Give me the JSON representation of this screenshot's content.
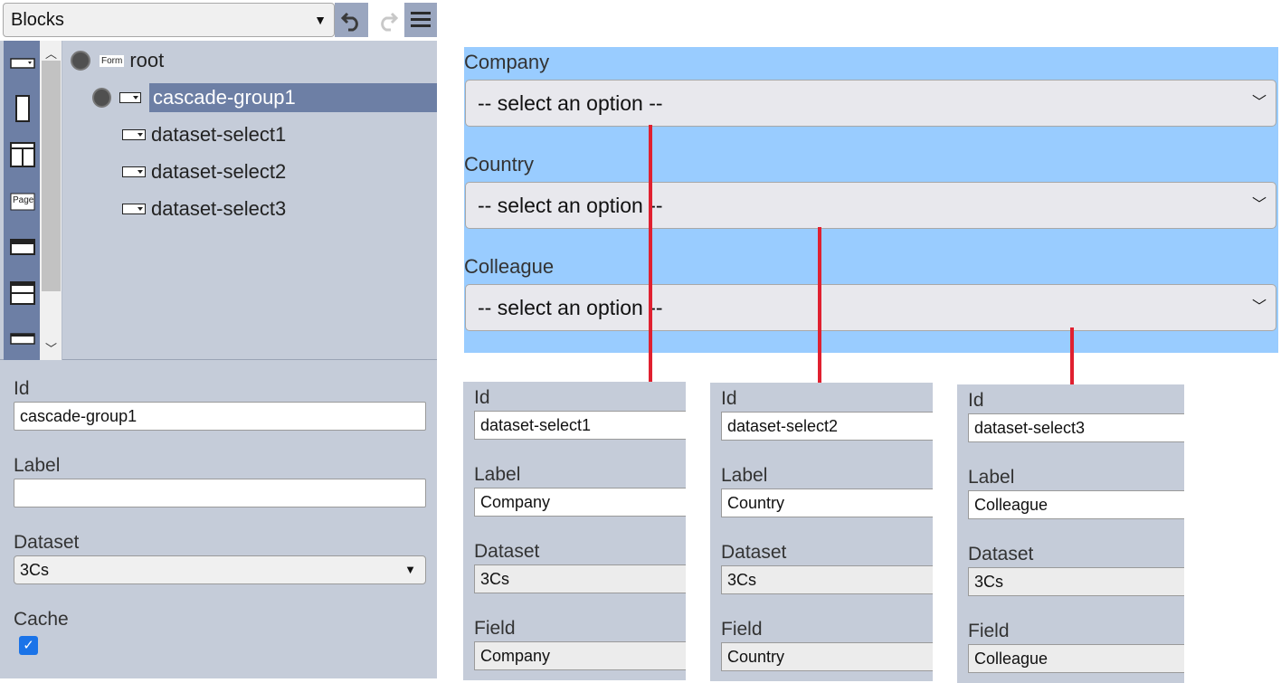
{
  "toolbar": {
    "block_select_value": "Blocks",
    "undo_icon": "undo-icon",
    "redo_icon": "redo-icon",
    "menu_icon": "hamburger-menu-icon"
  },
  "palette": {
    "items": [
      "dropdown-icon",
      "single-panel-icon",
      "two-column-icon",
      "page-icon",
      "header-bar-icon",
      "split-row-icon",
      "input-bar-icon"
    ],
    "page_label": "Page"
  },
  "tree": {
    "root_badge": "Form",
    "root_label": "root",
    "nodes": [
      {
        "label": "cascade-group1",
        "selected": true
      },
      {
        "label": "dataset-select1"
      },
      {
        "label": "dataset-select2"
      },
      {
        "label": "dataset-select3"
      }
    ]
  },
  "properties": {
    "id_label": "Id",
    "id_value": "cascade-group1",
    "label_label": "Label",
    "label_value": "",
    "dataset_label": "Dataset",
    "dataset_value": "3Cs",
    "cache_label": "Cache",
    "cache_checked": true
  },
  "preview": {
    "fields": [
      {
        "label": "Company",
        "placeholder": "-- select an option --"
      },
      {
        "label": "Country",
        "placeholder": "-- select an option --"
      },
      {
        "label": "Colleague",
        "placeholder": "-- select an option --"
      }
    ]
  },
  "cards": [
    {
      "id_label": "Id",
      "id": "dataset-select1",
      "label_label": "Label",
      "label": "Company",
      "dataset_label": "Dataset",
      "dataset": "3Cs",
      "field_label": "Field",
      "field": "Company"
    },
    {
      "id_label": "Id",
      "id": "dataset-select2",
      "label_label": "Label",
      "label": "Country",
      "dataset_label": "Dataset",
      "dataset": "3Cs",
      "field_label": "Field",
      "field": "Country"
    },
    {
      "id_label": "Id",
      "id": "dataset-select3",
      "label_label": "Label",
      "label": "Colleague",
      "dataset_label": "Dataset",
      "dataset": "3Cs",
      "field_label": "Field",
      "field": "Colleague"
    }
  ],
  "colors": {
    "accent": "#6d7fa5",
    "panel": "#c5ccd9",
    "preview_bg": "#99ccff",
    "connector": "#e02030",
    "checkbox": "#1a73e8"
  }
}
